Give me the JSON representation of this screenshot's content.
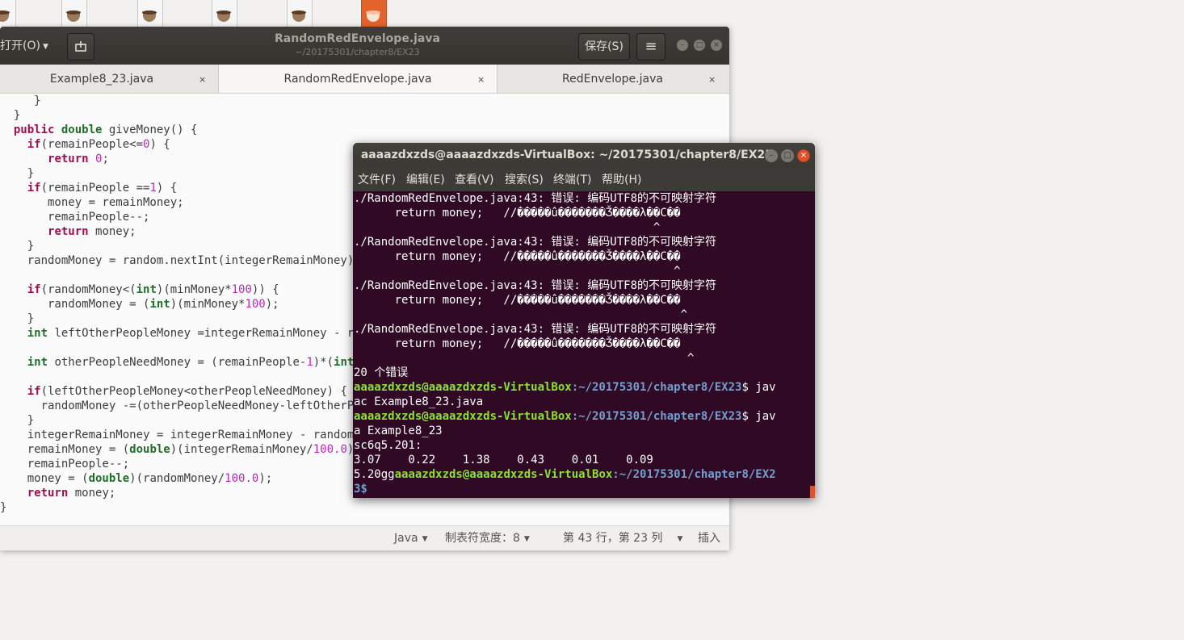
{
  "desktop": {
    "icons": [
      {
        "name": "java-file-icon"
      },
      {
        "name": "java-file-icon"
      },
      {
        "name": "java-file-icon"
      },
      {
        "name": "java-file-icon"
      },
      {
        "name": "java-file-icon"
      },
      {
        "name": "java-file-icon-orange"
      }
    ]
  },
  "gedit": {
    "open_label": "打开(O)",
    "title": "RandomRedEnvelope.java",
    "subtitle": "~/20175301/chapter8/EX23",
    "save_label": "保存(S)",
    "menu_icon": "≡",
    "tabs": [
      {
        "label": "Example8_23.java",
        "close": "×"
      },
      {
        "label": "RandomRedEnvelope.java",
        "close": "×"
      },
      {
        "label": "RedEnvelope.java",
        "close": "×"
      }
    ],
    "status": {
      "language": "Java",
      "tab_width": "制表符宽度：8",
      "position": "第 43 行，第 23 列",
      "insert_mode": "插入"
    }
  },
  "terminal": {
    "title": "aaaazdxzds@aaaazdxzds-VirtualBox: ~/20175301/chapter8/EX23",
    "menu": [
      "文件(F)",
      "编辑(E)",
      "查看(V)",
      "搜索(S)",
      "终端(T)",
      "帮助(H)"
    ],
    "user_host": "aaaazdxzds@aaaazdxzds-VirtualBox",
    "path_prefix": ":~/20175301/chapter8/EX23",
    "errors": [
      {
        "file": "./RandomRedEnvelope.java:43: 错误: 编码UTF8的不可映射字符",
        "code": "      return money;   //�����û�������Ǯ����λ��С��",
        "caret": "                                            ^"
      },
      {
        "file": "./RandomRedEnvelope.java:43: 错误: 编码UTF8的不可映射字符",
        "code": "      return money;   //�����û�������Ǯ����λ��С��",
        "caret": "                                               ^"
      },
      {
        "file": "./RandomRedEnvelope.java:43: 错误: 编码UTF8的不可映射字符",
        "code": "      return money;   //�����û�������Ǯ����λ��С��",
        "caret": "                                                ^"
      },
      {
        "file": "./RandomRedEnvelope.java:43: 错误: 编码UTF8的不可映射字符",
        "code": "      return money;   //�����û�������Ǯ����λ��С��",
        "caret": "                                                 ^"
      }
    ],
    "error_count": "20 个错误",
    "cmd1_tail": " jav",
    "cmd1_wrap": "ac Example8_23.java",
    "cmd2_tail": " jav",
    "cmd2_wrap": "a Example8_23",
    "output1": "sc6q5.201:",
    "output2": "3.07    0.22    1.38    0.43    0.01    0.09",
    "last_prefix": "5.20gg",
    "last_path": ":~/20175301/chapter8/EX2",
    "last_wrap": "3$"
  }
}
